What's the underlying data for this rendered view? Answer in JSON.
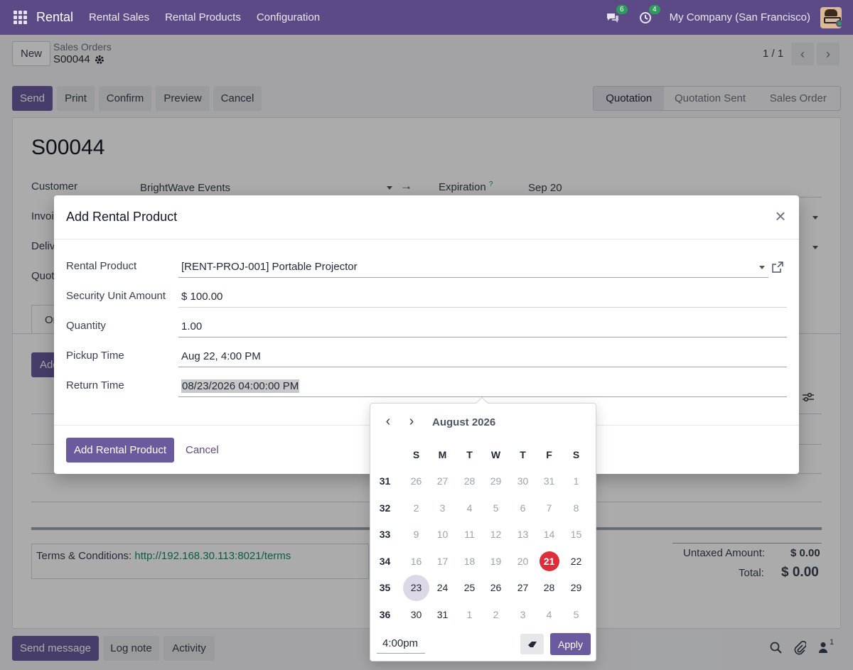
{
  "navbar": {
    "brand": "Rental",
    "menu": [
      "Rental Sales",
      "Rental Products",
      "Configuration"
    ],
    "messages_count": "6",
    "activities_count": "4",
    "company": "My Company (San Francisco)"
  },
  "control_panel": {
    "new_label": "New",
    "breadcrumb_parent": "Sales Orders",
    "breadcrumb_current": "S00044",
    "pager": "1 / 1"
  },
  "actions": [
    "Send",
    "Print",
    "Confirm",
    "Preview",
    "Cancel"
  ],
  "statusbar": [
    "Quotation",
    "Quotation Sent",
    "Sales Order"
  ],
  "form": {
    "title": "S00044",
    "customer_label": "Customer",
    "customer_value": "BrightWave Events",
    "expiration_label": "Expiration",
    "expiration_help": "?",
    "expiration_value": "Sep 20",
    "invoice_label_partial": "Invoi",
    "delivery_label_partial": "Deliv",
    "quote_label_partial": "Quot",
    "tab_partial": "Or",
    "add_partial": "Add",
    "terms_label": "Terms & Conditions:",
    "terms_link": "http://192.168.30.113:8021/terms",
    "untaxed_label": "Untaxed Amount:",
    "untaxed_value": "$ 0.00",
    "total_label": "Total:",
    "total_value": "$ 0.00"
  },
  "chatter": {
    "send_message": "Send message",
    "log_note": "Log note",
    "activity": "Activity",
    "followers_count": "1"
  },
  "dialog": {
    "title": "Add Rental Product",
    "rental_product_label": "Rental Product",
    "rental_product_value": "[RENT-PROJ-001] Portable Projector",
    "security_label": "Security Unit Amount",
    "security_value": "$ 100.00",
    "quantity_label": "Quantity",
    "quantity_value": "1.00",
    "pickup_label": "Pickup Time",
    "pickup_value": "Aug 22, 4:00 PM",
    "return_label": "Return Time",
    "return_value": "08/23/2026 04:00:00 PM",
    "primary_button": "Add Rental Product",
    "cancel_button": "Cancel"
  },
  "datepicker": {
    "month_label": "August 2026",
    "weekdays": [
      "S",
      "M",
      "T",
      "W",
      "T",
      "F",
      "S"
    ],
    "weeks": [
      {
        "num": "31",
        "days": [
          "26",
          "27",
          "28",
          "29",
          "30",
          "31",
          "1"
        ],
        "muted": [
          1,
          1,
          1,
          1,
          1,
          1,
          1
        ]
      },
      {
        "num": "32",
        "days": [
          "2",
          "3",
          "4",
          "5",
          "6",
          "7",
          "8"
        ],
        "muted": [
          1,
          1,
          1,
          1,
          1,
          1,
          1
        ]
      },
      {
        "num": "33",
        "days": [
          "9",
          "10",
          "11",
          "12",
          "13",
          "14",
          "15"
        ],
        "muted": [
          1,
          1,
          1,
          1,
          1,
          1,
          1
        ]
      },
      {
        "num": "34",
        "days": [
          "16",
          "17",
          "18",
          "19",
          "20",
          "21",
          "22"
        ],
        "muted": [
          1,
          1,
          1,
          1,
          1,
          0,
          0
        ]
      },
      {
        "num": "35",
        "days": [
          "23",
          "24",
          "25",
          "26",
          "27",
          "28",
          "29"
        ],
        "muted": [
          0,
          0,
          0,
          0,
          0,
          0,
          0
        ]
      },
      {
        "num": "36",
        "days": [
          "30",
          "31",
          "1",
          "2",
          "3",
          "4",
          "5"
        ],
        "muted": [
          0,
          0,
          1,
          1,
          1,
          1,
          1
        ]
      }
    ],
    "today": "21",
    "selected": "23",
    "time_value": "4:00pm",
    "apply_label": "Apply"
  },
  "colors": {
    "navbar": "#5b4a85",
    "primary": "#6c5a9e",
    "today": "#dc2f3c",
    "link": "#0f8a6e"
  }
}
